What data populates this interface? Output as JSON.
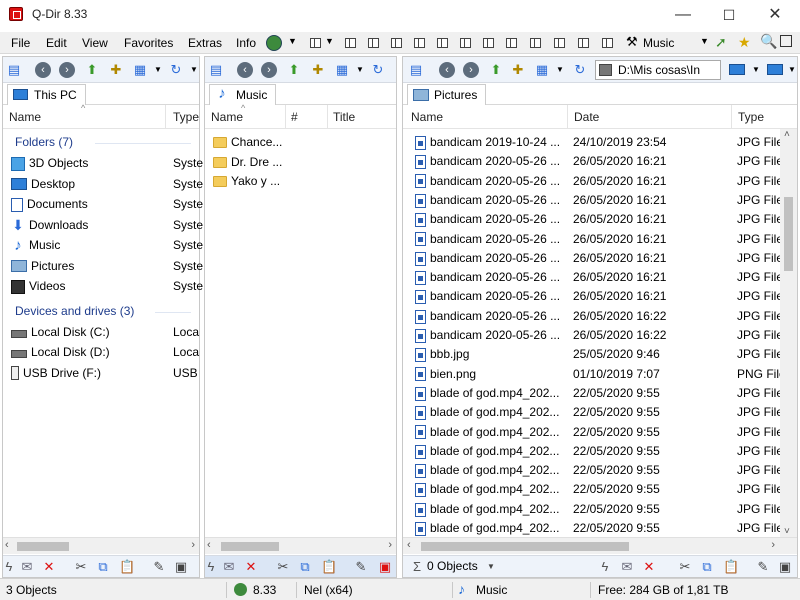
{
  "window": {
    "title": "Q-Dir 8.33",
    "minimize": "—",
    "maximize": "☐",
    "close": "✕"
  },
  "menu": {
    "items": [
      "File",
      "Edit",
      "View",
      "Favorites",
      "Extras",
      "Info"
    ],
    "music_label": "Music"
  },
  "left_pane": {
    "tab": "This PC",
    "columns": [
      "Name",
      "Type"
    ],
    "groups": [
      {
        "label": "Folders (7)",
        "items": [
          {
            "name": "3D Objects",
            "type": "Syste",
            "icon": "cube-icon"
          },
          {
            "name": "Desktop",
            "type": "Syste",
            "icon": "monitor-icon"
          },
          {
            "name": "Documents",
            "type": "Syste",
            "icon": "document-icon"
          },
          {
            "name": "Downloads",
            "type": "Syste",
            "icon": "download-icon"
          },
          {
            "name": "Music",
            "type": "Syste",
            "icon": "music-note-icon"
          },
          {
            "name": "Pictures",
            "type": "Syste",
            "icon": "picture-icon"
          },
          {
            "name": "Videos",
            "type": "Syste",
            "icon": "video-icon"
          }
        ]
      },
      {
        "label": "Devices and drives (3)",
        "items": [
          {
            "name": "Local Disk (C:)",
            "type": "Loca",
            "icon": "drive-icon"
          },
          {
            "name": "Local Disk (D:)",
            "type": "Loca",
            "icon": "drive-icon"
          },
          {
            "name": "USB Drive (F:)",
            "type": "USB",
            "icon": "usb-icon"
          }
        ]
      }
    ]
  },
  "middle_pane": {
    "tab": "Music",
    "columns": [
      "Name",
      "#",
      "Title"
    ],
    "items": [
      "Chance...",
      "Dr. Dre ...",
      "Yako y ..."
    ]
  },
  "right_pane": {
    "tab": "Pictures",
    "address": "D:\\Mis cosas\\In",
    "columns": [
      "Name",
      "Date",
      "Type"
    ],
    "items": [
      {
        "name": "bandicam 2019-10-24 ...",
        "date": "24/10/2019 23:54",
        "type": "JPG File"
      },
      {
        "name": "bandicam 2020-05-26 ...",
        "date": "26/05/2020 16:21",
        "type": "JPG File"
      },
      {
        "name": "bandicam 2020-05-26 ...",
        "date": "26/05/2020 16:21",
        "type": "JPG File"
      },
      {
        "name": "bandicam 2020-05-26 ...",
        "date": "26/05/2020 16:21",
        "type": "JPG File"
      },
      {
        "name": "bandicam 2020-05-26 ...",
        "date": "26/05/2020 16:21",
        "type": "JPG File"
      },
      {
        "name": "bandicam 2020-05-26 ...",
        "date": "26/05/2020 16:21",
        "type": "JPG File"
      },
      {
        "name": "bandicam 2020-05-26 ...",
        "date": "26/05/2020 16:21",
        "type": "JPG File"
      },
      {
        "name": "bandicam 2020-05-26 ...",
        "date": "26/05/2020 16:21",
        "type": "JPG File"
      },
      {
        "name": "bandicam 2020-05-26 ...",
        "date": "26/05/2020 16:21",
        "type": "JPG File"
      },
      {
        "name": "bandicam 2020-05-26 ...",
        "date": "26/05/2020 16:22",
        "type": "JPG File"
      },
      {
        "name": "bandicam 2020-05-26 ...",
        "date": "26/05/2020 16:22",
        "type": "JPG File"
      },
      {
        "name": "bbb.jpg",
        "date": "25/05/2020 9:46",
        "type": "JPG File"
      },
      {
        "name": "bien.png",
        "date": "01/10/2019 7:07",
        "type": "PNG File"
      },
      {
        "name": "blade of god.mp4_202...",
        "date": "22/05/2020 9:55",
        "type": "JPG File"
      },
      {
        "name": "blade of god.mp4_202...",
        "date": "22/05/2020 9:55",
        "type": "JPG File"
      },
      {
        "name": "blade of god.mp4_202...",
        "date": "22/05/2020 9:55",
        "type": "JPG File"
      },
      {
        "name": "blade of god.mp4_202...",
        "date": "22/05/2020 9:55",
        "type": "JPG File"
      },
      {
        "name": "blade of god.mp4_202...",
        "date": "22/05/2020 9:55",
        "type": "JPG File"
      },
      {
        "name": "blade of god.mp4_202...",
        "date": "22/05/2020 9:55",
        "type": "JPG File"
      },
      {
        "name": "blade of god.mp4_202...",
        "date": "22/05/2020 9:55",
        "type": "JPG File"
      },
      {
        "name": "blade of god.mp4_202...",
        "date": "22/05/2020 9:55",
        "type": "JPG File"
      }
    ],
    "objects_label": "0 Objects"
  },
  "status": {
    "objects": "3 Objects",
    "version": "8.33",
    "user": "Nel (x64)",
    "location": "Music",
    "free": "Free: 284 GB of 1,81 TB"
  }
}
